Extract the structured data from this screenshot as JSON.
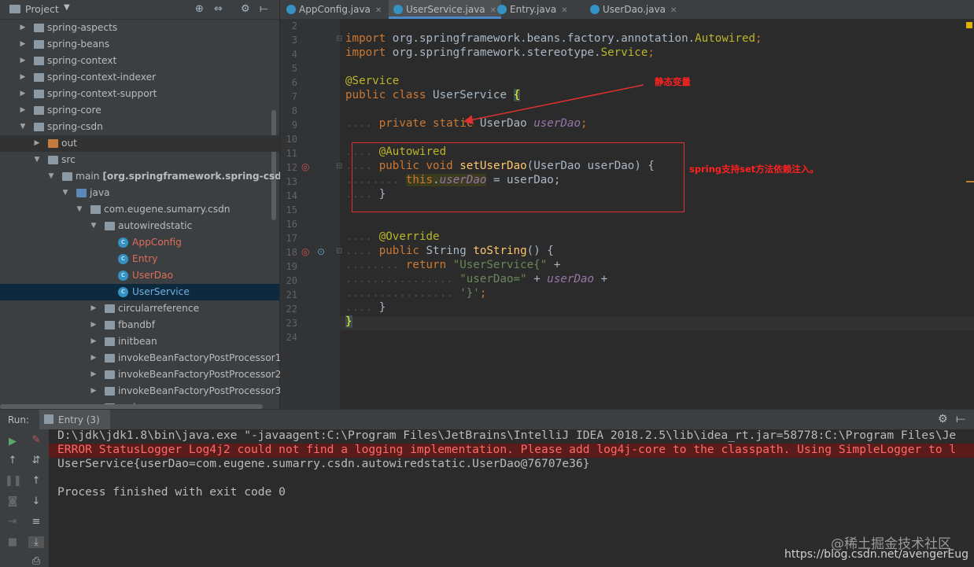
{
  "project_panel": {
    "title": "Project",
    "tree": [
      {
        "label": "spring-aspects"
      },
      {
        "label": "spring-beans"
      },
      {
        "label": "spring-context"
      },
      {
        "label": "spring-context-indexer"
      },
      {
        "label": "spring-context-support"
      },
      {
        "label": "spring-core"
      },
      {
        "label": "spring-csdn"
      },
      {
        "label": "out"
      },
      {
        "label": "src"
      },
      {
        "label": "main",
        "suffix": "[org.springframework.spring-csdn.ma"
      },
      {
        "label": "java"
      },
      {
        "label": "com.eugene.sumarry.csdn"
      },
      {
        "label": "autowiredstatic"
      },
      {
        "label": "AppConfig"
      },
      {
        "label": "Entry"
      },
      {
        "label": "UserDao"
      },
      {
        "label": "UserService"
      },
      {
        "label": "circularreference"
      },
      {
        "label": "fbandbf"
      },
      {
        "label": "initbean"
      },
      {
        "label": "invokeBeanFactoryPostProcessor1"
      },
      {
        "label": "invokeBeanFactoryPostProcessor2"
      },
      {
        "label": "invokeBeanFactoryPostProcessor3"
      },
      {
        "label": "springmvc"
      }
    ]
  },
  "tabs": [
    {
      "label": "AppConfig.java"
    },
    {
      "label": "UserService.java"
    },
    {
      "label": "Entry.java"
    },
    {
      "label": "UserDao.java"
    }
  ],
  "editor": {
    "line_numbers": [
      "2",
      "3",
      "4",
      "5",
      "6",
      "7",
      "8",
      "9",
      "10",
      "11",
      "12",
      "13",
      "14",
      "15",
      "16",
      "17",
      "18",
      "19",
      "20",
      "21",
      "22",
      "23",
      "24"
    ],
    "import1_kw": "import",
    "import1_pkg": "org.springframework.beans.factory.annotation.",
    "import1_cls": "Autowired",
    "import2_kw": "import",
    "import2_pkg": "org.springframework.stereotype.",
    "import2_cls": "Service",
    "service_ann": "@Service",
    "class_mods": "public class",
    "class_name": "UserService",
    "field_mods": "private static",
    "field_type": "UserDao",
    "field_name": "userDao",
    "autowired_ann": "@Autowired",
    "setter_mods": "public void",
    "setter_name": "setUserDao",
    "setter_params": "(UserDao userDao) {",
    "this_kw": "this",
    "this_field": "userDao",
    "assign_rest": " = userDao;",
    "close_brace": "}",
    "override_ann": "@Override",
    "tostring_mods": "public",
    "tostring_type": "String",
    "tostring_name": "toString",
    "tostring_params": "() {",
    "return_kw": "return",
    "str1": "\"UserService{\"",
    "plus": "+",
    "str2": "\"userDao=\"",
    "str3": "'}'",
    "final_brace": "}"
  },
  "annotations": {
    "static_var_note": "静态变量",
    "setter_note": "spring支持set方法依赖注入。"
  },
  "run_panel": {
    "label": "Run:",
    "tab_label": "Entry (3)",
    "console": [
      "D:\\jdk\\jdk1.8\\bin\\java.exe \"-javaagent:C:\\Program Files\\JetBrains\\IntelliJ IDEA 2018.2.5\\lib\\idea_rt.jar=58778:C:\\Program Files\\Je",
      "ERROR StatusLogger Log4j2 could not find a logging implementation. Please add log4j-core to the classpath. Using SimpleLogger to l",
      "UserService{userDao=com.eugene.sumarry.csdn.autowiredstatic.UserDao@76707e36}",
      "",
      "Process finished with exit code 0"
    ]
  },
  "watermarks": {
    "site": "@稀土掘金技术社区",
    "url": "https://blog.csdn.net/avengerEug"
  },
  "colors": {
    "bg": "#2b2b2b",
    "panel": "#3c3f41",
    "keyword": "#cc7832",
    "annotation": "#bbb529",
    "string": "#6a8759",
    "field": "#9876aa",
    "method": "#ffc66d",
    "error": "#ff6b68",
    "note_red": "#ff2020"
  }
}
